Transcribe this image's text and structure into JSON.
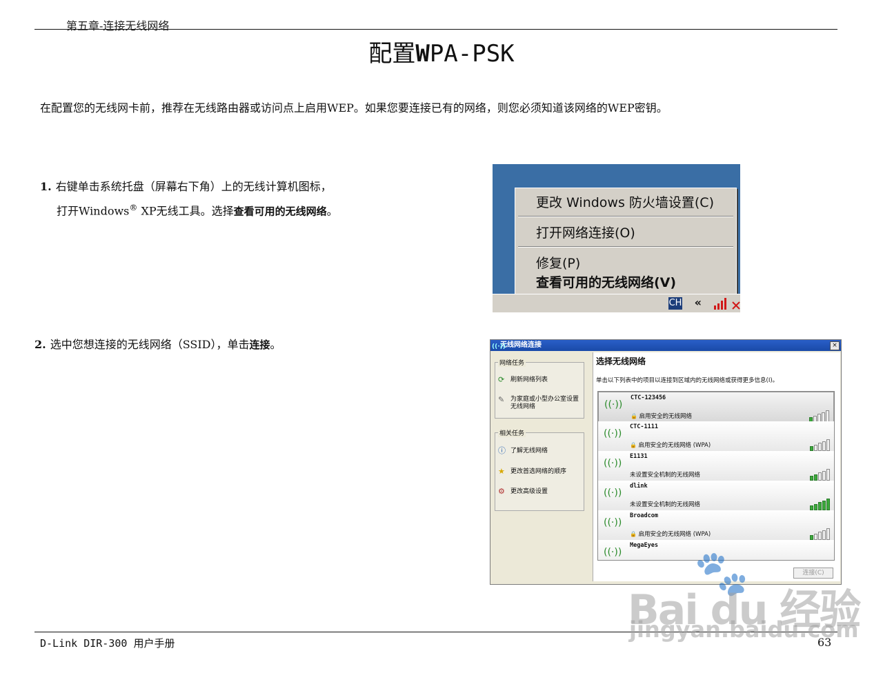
{
  "header": {
    "chapter": "第五章-连接无线网络",
    "title_prefix": "配置",
    "title_bold": "W",
    "title_rest": "PA-PSK"
  },
  "intro": "在配置您的无线网卡前，推荐在无线路由器或访问点上启用WEP。如果您要连接已有的网络，则您必须知道该网络的WEP密钥。",
  "steps": [
    {
      "num": "1.",
      "line1": "右键单击系统托盘（屏幕右下角）上的无线计算机图标，",
      "line2_a": "打开Windows",
      "line2_sup": "®",
      "line2_b": " XP无线工具。选择",
      "line2_em": "查看可用的无线网络",
      "line2_end": "。"
    },
    {
      "num": "2.",
      "text_a": "选中您想连接的无线网络（SSID），单击",
      "text_em": "连接",
      "text_end": "。"
    }
  ],
  "context_menu": {
    "items": [
      "更改 Windows 防火墙设置(C)",
      "打开网络连接(O)",
      "修复(P)",
      "查看可用的无线网络(V)"
    ],
    "tray_ch": "CH",
    "tray_arrows": "«"
  },
  "wireless_window": {
    "title": "无线网络连接",
    "close": "×",
    "network_tasks_title": "网络任务",
    "network_tasks": [
      "刷新网络列表",
      "为家庭或小型办公室设置无线网络"
    ],
    "related_tasks_title": "相关任务",
    "related_tasks": [
      "了解无线网络",
      "更改首选网络的顺序",
      "更改高级设置"
    ],
    "pane_title": "选择无线网络",
    "pane_desc": "单击以下列表中的项目以连接到区域内的无线网络或获得更多信息(I)。",
    "networks": [
      {
        "ssid": "CTC-123456",
        "security": "启用安全的无线网络",
        "lock": true,
        "signal": 0.2
      },
      {
        "ssid": "CTC-1111",
        "security": "启用安全的无线网络 (WPA)",
        "lock": true,
        "signal": 0.2
      },
      {
        "ssid": "E1131",
        "security": "未设置安全机制的无线网络",
        "lock": false,
        "signal": 0.4
      },
      {
        "ssid": "dlink",
        "security": "未设置安全机制的无线网络",
        "lock": false,
        "signal": 1.0
      },
      {
        "ssid": "Broadcom",
        "security": "启用安全的无线网络 (WPA)",
        "lock": true,
        "signal": 0.2
      },
      {
        "ssid": "MegaEyes",
        "security": "",
        "lock": false,
        "signal": 0
      }
    ],
    "connect_button": "连接(C)"
  },
  "footer": {
    "left": "D-Link DIR-300 用户手册",
    "page": "63"
  },
  "watermark": {
    "main": "Bai du 经验",
    "sub": "jingyan.baidu.com"
  },
  "icons": {
    "wireless": "wireless-antenna-icon",
    "lock": "lock-icon",
    "refresh": "refresh-icon",
    "info": "info-icon",
    "star": "star-icon"
  }
}
